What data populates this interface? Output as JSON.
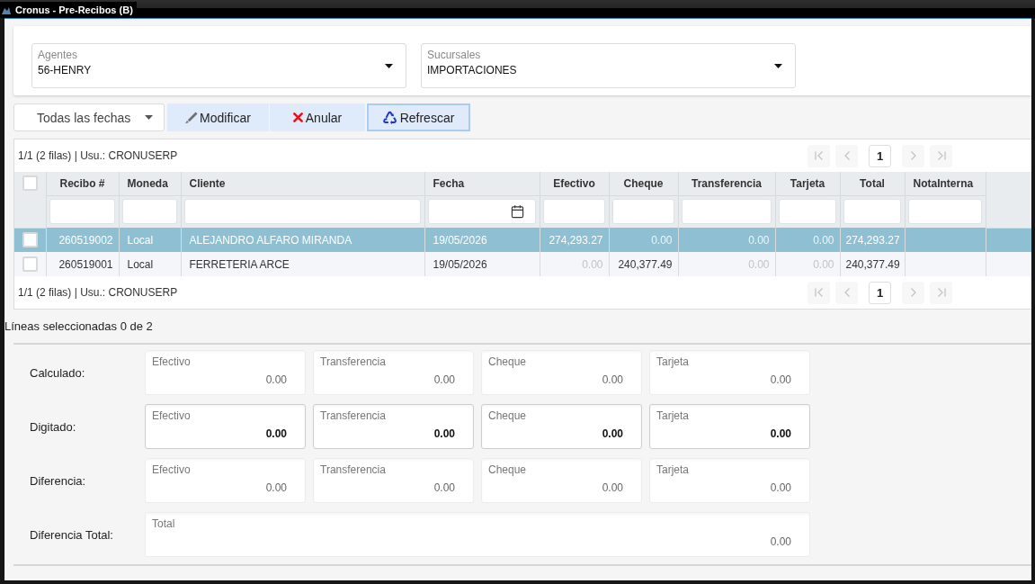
{
  "window": {
    "title": "Cronus - Pre-Recibos (B)"
  },
  "filters": [
    {
      "label": "Agentes",
      "value": "56-HENRY"
    },
    {
      "label": "Sucursales",
      "value": "IMPORTACIONES"
    }
  ],
  "toolbar": {
    "date_filter": "Todas las fechas",
    "buttons": [
      {
        "kind": "edit",
        "label": "Modificar",
        "focused": false
      },
      {
        "kind": "cancel",
        "label": "Anular",
        "focused": false
      },
      {
        "kind": "refresh",
        "label": "Refrescar",
        "focused": true
      }
    ]
  },
  "table": {
    "top_bar": {
      "info": "1/1 (2 filas) | Usu.: CRONUSERP",
      "pager": [
        {
          "kind": "first",
          "disabled": true
        },
        {
          "kind": "prev",
          "disabled": true
        },
        {
          "kind": "page",
          "label": "1",
          "selected": true
        },
        {
          "kind": "next",
          "disabled": true
        },
        {
          "kind": "last",
          "disabled": true
        }
      ]
    },
    "select_all": {
      "checked": false
    },
    "columns": [
      {
        "label": "Recibo #",
        "kind": "number"
      },
      {
        "label": "Moneda",
        "kind": "text"
      },
      {
        "label": "Cliente",
        "kind": "text"
      },
      {
        "label": "Fecha",
        "kind": "date"
      },
      {
        "label": "Efectivo",
        "kind": "number"
      },
      {
        "label": "Cheque",
        "kind": "number"
      },
      {
        "label": "Transferencia",
        "kind": "number"
      },
      {
        "label": "Tarjeta",
        "kind": "number"
      },
      {
        "label": "Total",
        "kind": "number"
      },
      {
        "label": "NotaInterna",
        "kind": "text"
      }
    ],
    "rows": [
      {
        "selected": true,
        "checked": false,
        "cells": [
          {
            "text": "260519002",
            "muted": false
          },
          {
            "text": "Local",
            "muted": false
          },
          {
            "text": "ALEJANDRO ALFARO MIRANDA",
            "muted": false
          },
          {
            "text": "19/05/2026",
            "muted": false
          },
          {
            "text": "274,293.27",
            "muted": false
          },
          {
            "text": "0.00",
            "muted": true
          },
          {
            "text": "0.00",
            "muted": true
          },
          {
            "text": "0.00",
            "muted": true
          },
          {
            "text": "274,293.27",
            "muted": false
          }
        ]
      },
      {
        "selected": false,
        "checked": false,
        "cells": [
          {
            "text": "260519001",
            "muted": false
          },
          {
            "text": "Local",
            "muted": false
          },
          {
            "text": "FERRETERIA ARCE",
            "muted": false
          },
          {
            "text": "19/05/2026",
            "muted": false
          },
          {
            "text": "0.00",
            "muted": true
          },
          {
            "text": "240,377.49",
            "muted": false
          },
          {
            "text": "0.00",
            "muted": true
          },
          {
            "text": "0.00",
            "muted": true
          },
          {
            "text": "240,377.49",
            "muted": false
          }
        ]
      }
    ],
    "bottom_bar": {
      "info": "1/1 (2 filas) | Usu.: CRONUSERP",
      "pager": [
        {
          "kind": "first",
          "disabled": true
        },
        {
          "kind": "prev",
          "disabled": true
        },
        {
          "kind": "page",
          "label": "1",
          "selected": true
        },
        {
          "kind": "next",
          "disabled": true
        },
        {
          "kind": "last",
          "disabled": true
        }
      ]
    }
  },
  "selection_info": "Líneas seleccionadas 0 de 2",
  "summary": [
    {
      "label": "Calculado:",
      "fields": [
        {
          "label": "Efectivo",
          "value": "0.00",
          "editable": false
        },
        {
          "label": "Transferencia",
          "value": "0.00",
          "editable": false
        },
        {
          "label": "Cheque",
          "value": "0.00",
          "editable": false
        },
        {
          "label": "Tarjeta",
          "value": "0.00",
          "editable": false
        }
      ]
    },
    {
      "label": "Digitado:",
      "fields": [
        {
          "label": "Efectivo",
          "value": "0.00",
          "editable": true
        },
        {
          "label": "Transferencia",
          "value": "0.00",
          "editable": true
        },
        {
          "label": "Cheque",
          "value": "0.00",
          "editable": true
        },
        {
          "label": "Tarjeta",
          "value": "0.00",
          "editable": true
        }
      ]
    },
    {
      "label": "Diferencia:",
      "fields": [
        {
          "label": "Efectivo",
          "value": "0.00",
          "editable": false
        },
        {
          "label": "Transferencia",
          "value": "0.00",
          "editable": false
        },
        {
          "label": "Cheque",
          "value": "0.00",
          "editable": false
        },
        {
          "label": "Tarjeta",
          "value": "0.00",
          "editable": false
        }
      ]
    },
    {
      "label": "Diferencia Total:",
      "fields": [
        {
          "label": "Total",
          "value": "0.00",
          "editable": false
        }
      ]
    }
  ]
}
